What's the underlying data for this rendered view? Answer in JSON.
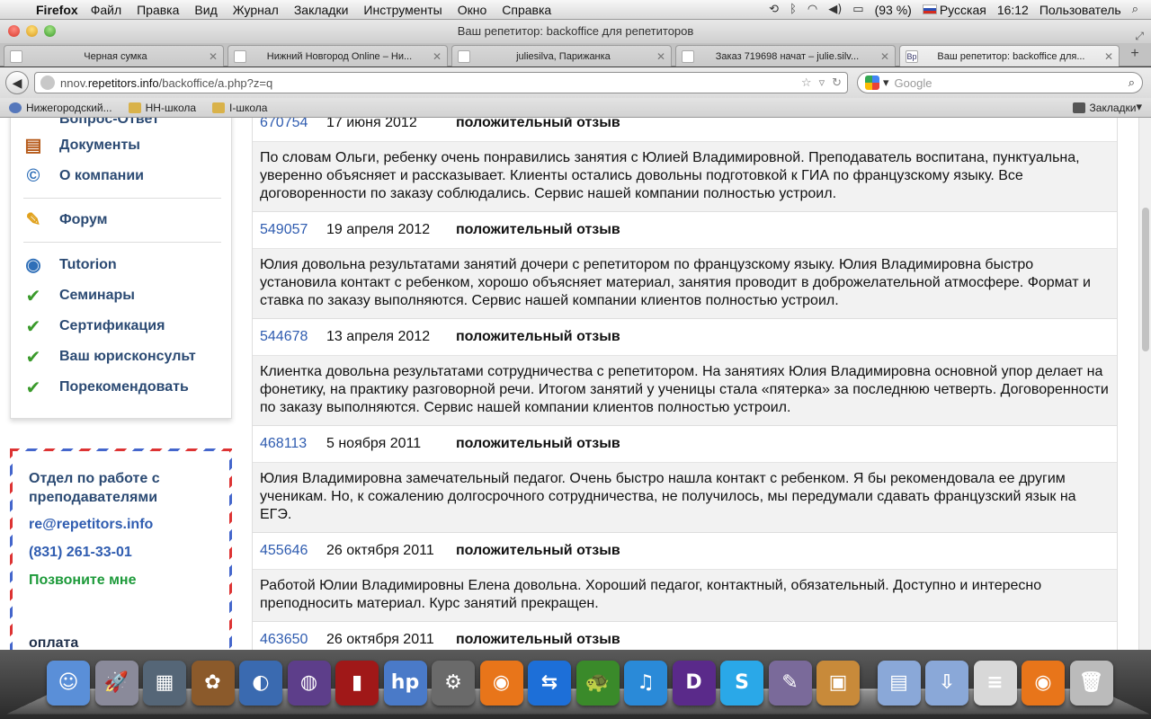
{
  "menubar": {
    "app": "Firefox",
    "menus": [
      "Файл",
      "Правка",
      "Вид",
      "Журнал",
      "Закладки",
      "Инструменты",
      "Окно",
      "Справка"
    ],
    "battery": "(93 %)",
    "input_lang": "Русская",
    "time": "16:12",
    "user": "Пользователь"
  },
  "window": {
    "title": "Ваш репетитор: backoffice для репетиторов"
  },
  "tabs": [
    {
      "title": "Черная сумка"
    },
    {
      "title": "Нижний Новгород Online – Ни..."
    },
    {
      "title": "juliesilva, Парижанка"
    },
    {
      "title": "Заказ 719698 начат – julie.silv..."
    },
    {
      "title": "Ваш репетитор: backoffice для..."
    }
  ],
  "navbar": {
    "url_prefix": "nnov.",
    "url_domain": "repetitors.info",
    "url_path": "/backoffice/a.php?z=q",
    "search_placeholder": "Google"
  },
  "bookmarks": {
    "items": [
      "Нижегородский...",
      "НН-школа",
      "I-школа"
    ],
    "right": "Закладки"
  },
  "sidebar": {
    "items": [
      {
        "label": "Вопрос-Ответ"
      },
      {
        "label": "Документы"
      },
      {
        "label": "О компании"
      },
      {
        "label": "Форум"
      },
      {
        "label": "Tutorion"
      },
      {
        "label": "Семинары"
      },
      {
        "label": "Сертификация"
      },
      {
        "label": "Ваш юрисконсульт"
      },
      {
        "label": "Порекомендовать"
      }
    ]
  },
  "contact": {
    "title": "Отдел по работе с преподавателями",
    "email": "re@repetitors.info",
    "phone": "(831) 261-33-01",
    "call_me": "Позвоните мне",
    "payment": "оплата"
  },
  "reviews": [
    {
      "id": "670754",
      "date": "17 июня 2012",
      "type": "положительный отзыв",
      "text": "По словам Ольги, ребенку очень понравились занятия с Юлией Владимировной. Преподаватель воспитана, пунктуальна, уверенно объясняет и рассказывает. Клиенты остались довольны подготовкой к ГИА по французскому языку. Все договоренности по заказу соблюдались. Сервис нашей компании полностью устроил."
    },
    {
      "id": "549057",
      "date": "19 апреля 2012",
      "type": "положительный отзыв",
      "text": "Юлия довольна результатами занятий дочери с репетитором по французскому языку. Юлия Владимировна быстро установила контакт с ребенком, хорошо объясняет материал, занятия проводит в доброжелательной атмосфере. Формат и ставка по заказу выполняются. Сервис нашей компании клиентов полностью устроил."
    },
    {
      "id": "544678",
      "date": "13 апреля 2012",
      "type": "положительный отзыв",
      "text": "Клиентка довольна результатами сотрудничества с репетитором. На занятиях Юлия Владимировна основной упор делает на фонетику, на практику разговорной речи. Итогом занятий у ученицы стала «пятерка» за последнюю четверть. Договоренности по заказу выполняются. Сервис нашей компании клиентов полностью устроил."
    },
    {
      "id": "468113",
      "date": "5 ноября 2011",
      "type": "положительный отзыв",
      "text": "Юлия Владимировна замечательный педагог. Очень быстро нашла контакт с ребенком. Я бы рекомендовала ее другим ученикам. Но, к сожалению долгосрочного сотрудничества, не получилось, мы передумали сдавать французский язык на ЕГЭ."
    },
    {
      "id": "455646",
      "date": "26 октября 2011",
      "type": "положительный отзыв",
      "text": "Работой Юлии Владимировны Елена довольна. Хороший педагог, контактный, обязательный. Доступно и интересно преподносить материал. Курс занятий прекращен."
    },
    {
      "id": "463650",
      "date": "26 октября 2011",
      "type": "положительный отзыв",
      "text": ""
    }
  ],
  "dock": {
    "icons": [
      "finder-icon",
      "launchpad-icon",
      "image-capture-icon",
      "iphoto-icon",
      "preview-icon",
      "dashboard-icon",
      "photo-booth-icon",
      "hp-utility-icon",
      "system-preferences-icon",
      "firefox-icon",
      "teamviewer-icon",
      "turtle-app-icon",
      "itunes-icon",
      "djvu-reader-icon",
      "skype-icon",
      "quill-app-icon",
      "iphoto-library-icon",
      "applications-folder-icon",
      "downloads-folder-icon",
      "document-stack-icon",
      "firefox-document-icon",
      "trash-icon"
    ]
  }
}
